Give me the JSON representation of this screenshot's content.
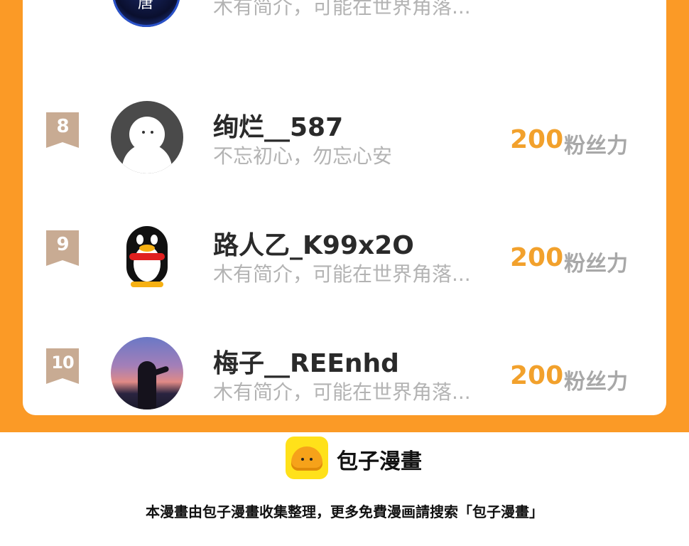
{
  "partial_row": {
    "intro": "木有简介，可能在世界角落..."
  },
  "rows": [
    {
      "rank": "8",
      "name": "绚烂__587",
      "intro": "不忘初心，勿忘心安",
      "score": "200",
      "score_unit": "粉丝力",
      "avatar_icon": "ghost-avatar"
    },
    {
      "rank": "9",
      "name": "路人乙_K99x2O",
      "intro": "木有简介，可能在世界角落...",
      "score": "200",
      "score_unit": "粉丝力",
      "avatar_icon": "qq-penguin-avatar"
    },
    {
      "rank": "10",
      "name": "梅子__REEnhd",
      "intro": "木有简介，可能在世界角落...",
      "score": "200",
      "score_unit": "粉丝力",
      "avatar_icon": "sunset-photo-avatar"
    }
  ],
  "footer": {
    "logo_text": "包子漫畫",
    "note": "本漫畫由包子漫畫收集整理，更多免費漫画請搜索「包子漫畫」"
  },
  "colors": {
    "background_band": "#fb9a26",
    "score": "#f2a12c",
    "rank_badge": "#c8ab93"
  }
}
